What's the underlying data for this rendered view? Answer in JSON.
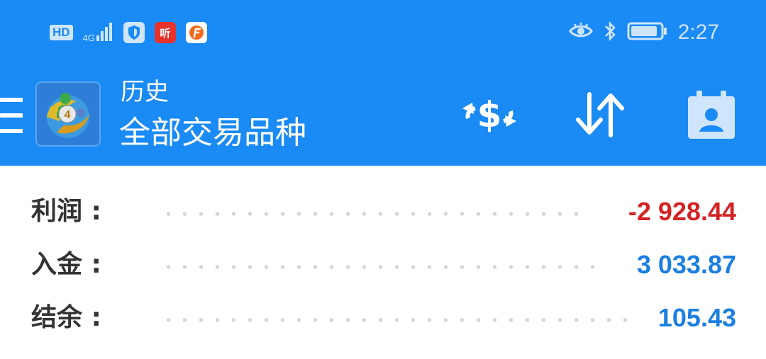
{
  "status_bar": {
    "hd_label": "HD",
    "network_label": "4G",
    "time": "2:27",
    "app_notification_label": "听",
    "icons": [
      "hd-icon",
      "signal-icon",
      "shield-icon",
      "ting-app-icon",
      "f-app-icon",
      "eye-comfort-icon",
      "bluetooth-icon",
      "battery-icon"
    ]
  },
  "header": {
    "title": "历史",
    "subtitle": "全部交易品种",
    "app_logo_badge": "4",
    "actions": [
      "currency-exchange-icon",
      "sort-icon",
      "calendar-contact-icon"
    ]
  },
  "summary": [
    {
      "label": "利润 :",
      "value": "-2 928.44",
      "color": "#d32323"
    },
    {
      "label": "入金 :",
      "value": "3 033.87",
      "color": "#1a7fe0"
    },
    {
      "label": "结余 :",
      "value": "105.43",
      "color": "#1a7fe0"
    }
  ],
  "colors": {
    "accent": "#1a8af5",
    "negative": "#d32323",
    "positive": "#1a7fe0"
  }
}
